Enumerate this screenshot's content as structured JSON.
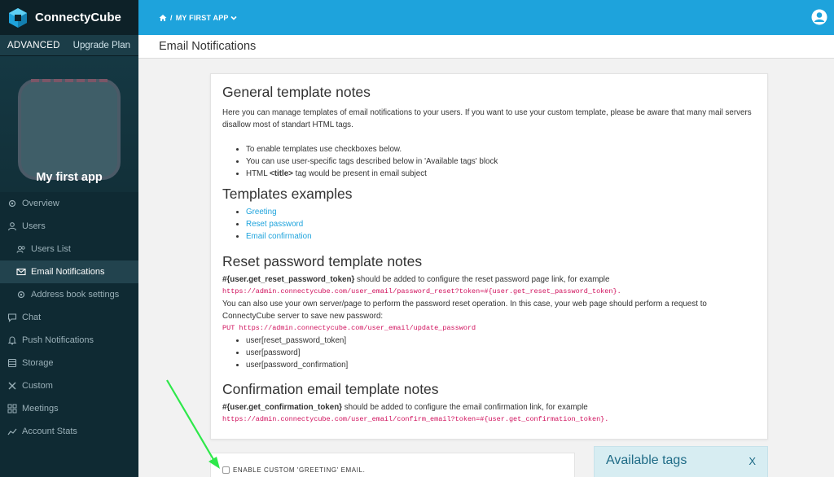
{
  "brand": {
    "name": "ConnectyCube"
  },
  "plan": {
    "name": "ADVANCED",
    "upgrade_label": "Upgrade Plan"
  },
  "app": {
    "name": "My first app"
  },
  "nav": {
    "overview": "Overview",
    "users": "Users",
    "users_list": "Users List",
    "email_notifications": "Email Notifications",
    "address_book": "Address book settings",
    "chat": "Chat",
    "push": "Push Notifications",
    "storage": "Storage",
    "custom": "Custom",
    "meetings": "Meetings",
    "account_stats": "Account Stats"
  },
  "topbar": {
    "sep": "/",
    "app_crumb": "MY FIRST APP"
  },
  "page": {
    "title": "Email Notifications"
  },
  "general": {
    "title": "General template notes",
    "intro": "Here you can manage templates of email notifications to your users. If you want to use your custom template, please be aware that many mail servers disallow most of standart HTML tags.",
    "bullets": [
      "To enable templates use checkboxes below.",
      "You can use user-specific tags described below in 'Available tags' block",
      "HTML <title> tag would be present in email subject"
    ],
    "bullet3_pre": "HTML ",
    "bullet3_tag": "<title>",
    "bullet3_post": " tag would be present in email subject"
  },
  "examples": {
    "title": "Templates examples",
    "links": [
      "Greeting",
      "Reset password",
      "Email confirmation"
    ]
  },
  "reset": {
    "title": "Reset password template notes",
    "tag": "#{user.get_reset_password_token}",
    "tag_text": " should be added to configure the reset password page link, for example",
    "url": "https://admin.connectycube.com/user_email/password_reset?token=#{user.get_reset_password_token}.",
    "alt_text": "You can also use your own server/page to perform the password reset operation. In this case, your web page should perform a request to ConnectyCube server to save new password:",
    "put_url": "PUT https://admin.connectycube.com/user_email/update_password",
    "params": [
      "user[reset_password_token]",
      "user[password]",
      "user[password_confirmation]"
    ]
  },
  "confirm": {
    "title": "Confirmation email template notes",
    "tag": "#{user.get_confirmation_token}",
    "tag_text": " should be added to configure the email confirmation link, for example",
    "url": "https://admin.connectycube.com/user_email/confirm_email?token=#{user.get_confirmation_token}."
  },
  "greeting": {
    "checkbox_label": "ENABLE CUSTOM 'GREETING' EMAIL."
  },
  "tags": {
    "title": "Available tags",
    "close": "X"
  },
  "colors": {
    "sidebar_bg": "#0f2a33",
    "topbar_bg": "#1ea3dc",
    "link": "#1ea3dc",
    "code": "#d0105c",
    "annotation_arrow": "#2ee84a"
  }
}
